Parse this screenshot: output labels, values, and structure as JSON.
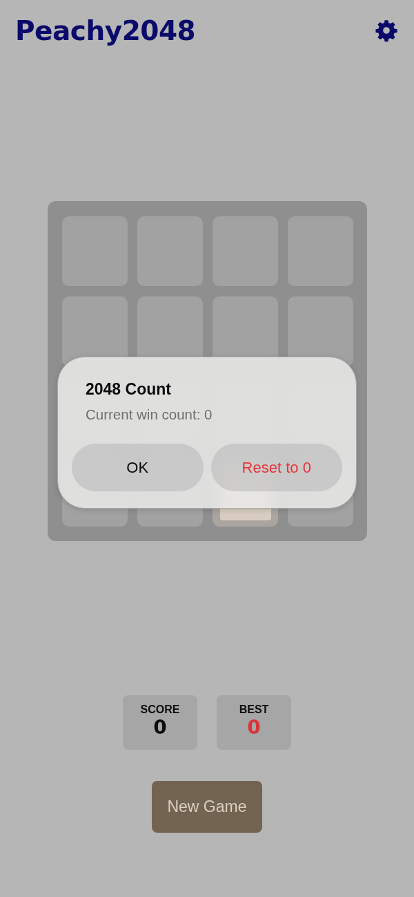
{
  "header": {
    "title": "Peachy2048"
  },
  "board": {
    "rows": [
      [
        {
          "filled": false
        },
        {
          "filled": false
        },
        {
          "filled": false
        },
        {
          "filled": false
        }
      ],
      [
        {
          "filled": false
        },
        {
          "filled": false
        },
        {
          "filled": false
        },
        {
          "filled": false
        }
      ],
      [
        {},
        {},
        {},
        {}
      ],
      [
        {
          "filled": false
        },
        {
          "filled": false
        },
        {
          "filled": true
        },
        {
          "filled": false
        }
      ]
    ]
  },
  "dialog": {
    "title": "2048 Count",
    "message": "Current win count: 0",
    "buttons": [
      {
        "label": "OK",
        "kind": "default"
      },
      {
        "label": "Reset to 0",
        "kind": "destructive"
      }
    ]
  },
  "scores": [
    {
      "label": "SCORE",
      "value": "0",
      "kind": "score"
    },
    {
      "label": "BEST",
      "value": "0",
      "kind": "best"
    }
  ],
  "new_game_button": {
    "label": "New Game"
  }
}
